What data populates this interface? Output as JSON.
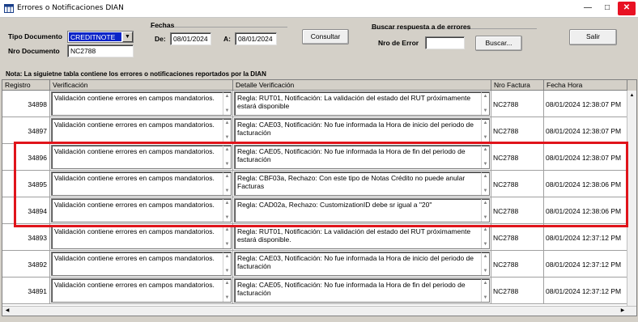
{
  "window": {
    "title": "Errores o Notificaciones DIAN"
  },
  "form": {
    "tipo_documento_label": "Tipo Documento",
    "tipo_documento_value": "CREDITNOTE",
    "nro_documento_label": "Nro Documento",
    "nro_documento_value": "NC2788",
    "fechas_label": "Fechas",
    "de_label": "De:",
    "de_value": "08/01/2024",
    "a_label": "A:",
    "a_value": "08/01/2024",
    "consultar_label": "Consultar",
    "buscar_group_label": "Buscar respuesta a de errores",
    "nro_error_label": "Nro de Error",
    "nro_error_value": "",
    "buscar_label": "Buscar...",
    "salir_label": "Salir"
  },
  "note": "Nota: La siguietne tabla contiene los errores o notificaciones reportados por la DIAN",
  "table": {
    "columns": [
      "Registro",
      "Verificación",
      "Detalle Verificación",
      "Nro Factura",
      "Fecha Hora"
    ],
    "rows": [
      {
        "registro": "34898",
        "verificacion": "Validación contiene errores en campos mandatorios.",
        "detalle": "Regla: RUT01, Notificación: La validación del estado del RUT próximamente estará disponible",
        "factura": "NC2788",
        "fecha": "08/01/2024 12:38:07 PM"
      },
      {
        "registro": "34897",
        "verificacion": "Validación contiene errores en campos mandatorios.",
        "detalle": "Regla: CAE03, Notificación: No fue informada la Hora de inicio del periodo de facturación",
        "factura": "NC2788",
        "fecha": "08/01/2024 12:38:07 PM"
      },
      {
        "registro": "34896",
        "verificacion": "Validación contiene errores en campos mandatorios.",
        "detalle": "Regla: CAE05, Notificación: No fue informada la Hora de fin del periodo de facturación",
        "factura": "NC2788",
        "fecha": "08/01/2024 12:38:07 PM"
      },
      {
        "registro": "34895",
        "verificacion": "Validación contiene errores en campos mandatorios.",
        "detalle": "Regla: CBF03a, Rechazo: Con este tipo de Notas Crédito no puede anular Facturas",
        "factura": "NC2788",
        "fecha": "08/01/2024 12:38:06 PM"
      },
      {
        "registro": "34894",
        "verificacion": "Validación contiene errores en campos mandatorios.",
        "detalle": "Regla: CAD02a, Rechazo: CustomizationID debe sr igual a \"20\"",
        "factura": "NC2788",
        "fecha": "08/01/2024 12:38:06 PM"
      },
      {
        "registro": "34893",
        "verificacion": "Validación contiene errores en campos mandatorios.",
        "detalle": "Regla: RUT01, Notificación: La validación del estado del RUT próximamente estará disponible.",
        "factura": "NC2788",
        "fecha": "08/01/2024 12:37:12 PM"
      },
      {
        "registro": "34892",
        "verificacion": "Validación contiene errores en campos mandatorios.",
        "detalle": "Regla: CAE03, Notificación: No fue informada la Hora de inicio del periodo de facturación",
        "factura": "NC2788",
        "fecha": "08/01/2024 12:37:12 PM"
      },
      {
        "registro": "34891",
        "verificacion": "Validación contiene errores en campos mandatorios.",
        "detalle": "Regla: CAE05, Notificación: No fue informada la Hora de fin del periodo de facturación",
        "factura": "NC2788",
        "fecha": "08/01/2024 12:37:12 PM"
      }
    ]
  },
  "colors": {
    "selection": "#0a24c8",
    "highlight_border": "#e0141b",
    "close_button": "#e81123"
  }
}
